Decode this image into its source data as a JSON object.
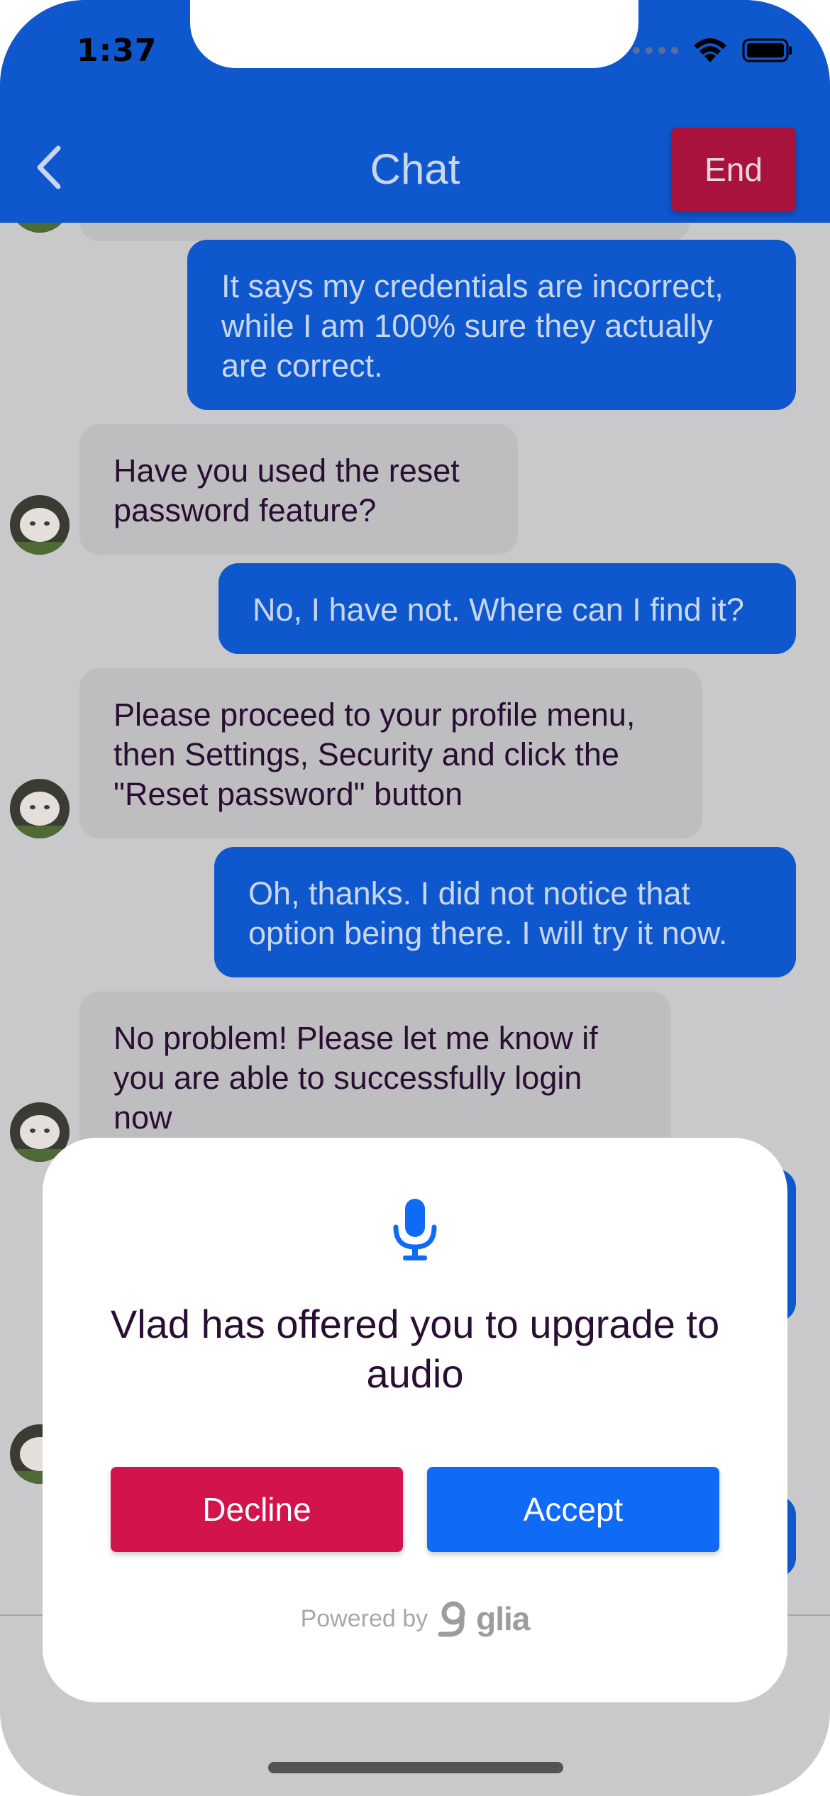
{
  "status_bar": {
    "time": "1:37"
  },
  "header": {
    "title": "Chat",
    "end_label": "End",
    "back_icon": "chevron-left-icon",
    "color": "#0f57cc",
    "end_color": "#a8123d"
  },
  "messages": [
    {
      "from": "visitor",
      "text": "It says my credentials are incorrect, while I am 100% sure they actually are correct."
    },
    {
      "from": "operator",
      "text": "Have you used the reset password feature?"
    },
    {
      "from": "visitor",
      "text": "No, I have not. Where can I find it?"
    },
    {
      "from": "operator",
      "text": "Please proceed to your profile menu, then Settings, Security and click the \"Reset password\" button"
    },
    {
      "from": "visitor",
      "text": "Oh, thanks. I did not notice that option being there. I will try it now."
    },
    {
      "from": "operator",
      "text": "No problem! Please let me know if you are able to successfully login now"
    }
  ],
  "dialog": {
    "icon": "microphone-icon",
    "title": "Vlad has offered you to upgrade to audio",
    "decline_label": "Decline",
    "accept_label": "Accept",
    "decline_color": "#d3134b",
    "accept_color": "#0f6bf5",
    "powered_by": "Powered by",
    "brand": "glia"
  }
}
